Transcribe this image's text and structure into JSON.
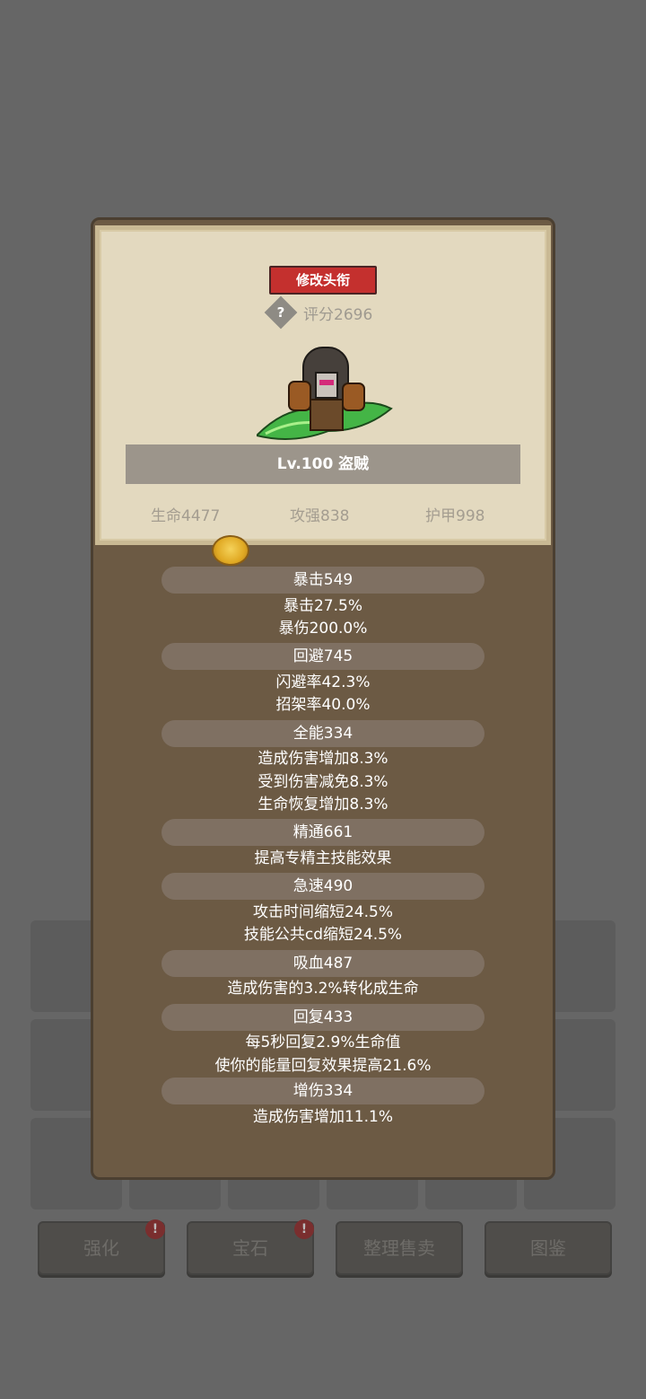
{
  "background": {
    "buttons": [
      {
        "label": "强化",
        "alert": "!"
      },
      {
        "label": "宝石",
        "alert": "!"
      },
      {
        "label": "整理售卖"
      },
      {
        "label": "图鉴"
      }
    ]
  },
  "profile": {
    "edit_title_label": "修改头衔",
    "help_icon": "?",
    "score_text": "评分2696",
    "name_text": "Lv.100 盗贼",
    "hp_text": "生命4477",
    "attack_text": "攻强838",
    "armor_text": "护甲998"
  },
  "stats": [
    {
      "header": "暴击549",
      "lines": [
        "暴击27.5%",
        "暴伤200.0%"
      ]
    },
    {
      "header": "回避745",
      "lines": [
        "闪避率42.3%",
        "招架率40.0%"
      ]
    },
    {
      "header": "全能334",
      "lines": [
        "造成伤害增加8.3%",
        "受到伤害减免8.3%",
        "生命恢复增加8.3%"
      ]
    },
    {
      "header": "精通661",
      "lines": [
        "提高专精主技能效果"
      ]
    },
    {
      "header": "急速490",
      "lines": [
        "攻击时间缩短24.5%",
        "技能公共cd缩短24.5%"
      ]
    },
    {
      "header": "吸血487",
      "lines": [
        "造成伤害的3.2%转化成生命"
      ]
    },
    {
      "header": "回复433",
      "lines": [
        "每5秒回复2.9%生命值",
        "使你的能量回复效果提高21.6%"
      ]
    },
    {
      "header": "增伤334",
      "lines": [
        "造成伤害增加11.1%"
      ]
    }
  ]
}
